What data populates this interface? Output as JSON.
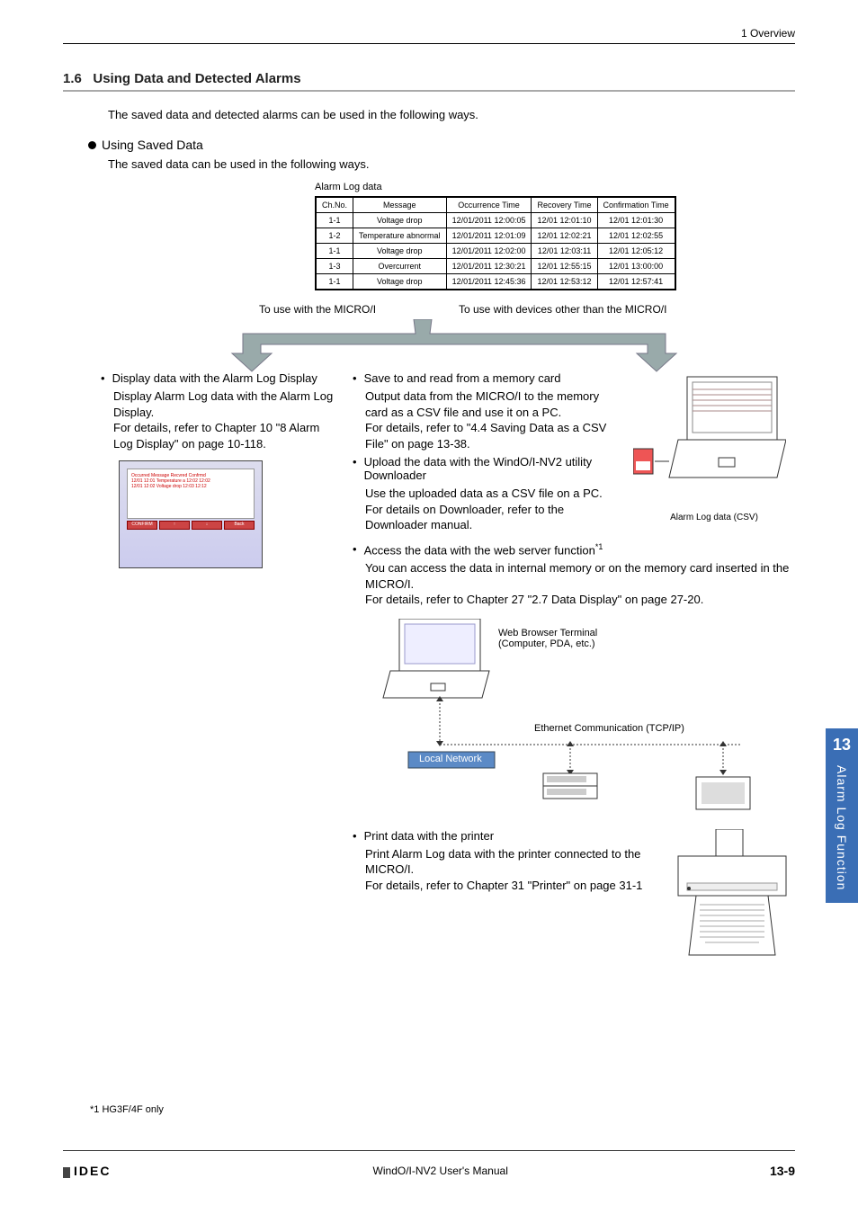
{
  "header": {
    "breadcrumb": "1 Overview"
  },
  "section": {
    "number": "1.6",
    "title": "Using Data and Detected Alarms",
    "intro": "The saved data and detected alarms can be used in the following ways."
  },
  "using_saved_data": {
    "heading": "Using Saved Data",
    "intro": "The saved data can be used in the following ways."
  },
  "alarm_table": {
    "caption": "Alarm Log data",
    "headers": [
      "Ch.No.",
      "Message",
      "Occurrence Time",
      "Recovery Time",
      "Confirmation Time"
    ],
    "rows": [
      [
        "1-1",
        "Voltage drop",
        "12/01/2011 12:00:05",
        "12/01 12:01:10",
        "12/01 12:01:30"
      ],
      [
        "1-2",
        "Temperature abnormal",
        "12/01/2011 12:01:09",
        "12/01 12:02:21",
        "12/01 12:02:55"
      ],
      [
        "1-1",
        "Voltage drop",
        "12/01/2011 12:02:00",
        "12/01 12:03:11",
        "12/01 12:05:12"
      ],
      [
        "1-3",
        "Overcurrent",
        "12/01/2011 12:30:21",
        "12/01 12:55:15",
        "12/01 13:00:00"
      ],
      [
        "1-1",
        "Voltage drop",
        "12/01/2011 12:45:36",
        "12/01 12:53:12",
        "12/01 12:57:41"
      ]
    ]
  },
  "arrows": {
    "left": "To use with the MICRO/I",
    "right": "To use with devices other than the MICRO/I"
  },
  "left_col": {
    "title": "Display data with the Alarm Log Display",
    "desc": "Display Alarm Log data with the Alarm Log Display.\nFor details, refer to Chapter 10 \"8 Alarm Log Display\" on page 10-118.",
    "mock_headers": "Occurred    Message    Recvred  Confrmd",
    "mock_rows": "12/01 12:01  Temperature a  12:02    12:02\n12/01 12:02  Voltage drop   12:03    12:12",
    "mock_buttons": [
      "CONFIRM",
      "↑",
      "↓",
      "Back"
    ]
  },
  "right_col": {
    "memcard": {
      "title": "Save to and read from a memory card",
      "desc": "Output data from the MICRO/I to the memory card as a CSV file and use it on a PC.\nFor details, refer to \"4.4 Saving Data as a CSV File\" on page 13-38."
    },
    "downloader": {
      "title": "Upload the data with the WindO/I-NV2 utility Downloader",
      "desc": "Use the uploaded data as a CSV file on a PC.\nFor details on Downloader, refer to the Downloader manual."
    },
    "csv_caption": "Alarm Log data (CSV)",
    "webserver": {
      "title_prefix": "Access the data with the web server function",
      "sup": "*1",
      "desc": "You can access the data in internal memory or on the memory card inserted in the MICRO/I.\nFor details, refer to Chapter 27 \"2.7 Data Display\" on page 27-20."
    },
    "web_labels": {
      "terminal": "Web Browser Terminal\n(Computer, PDA, etc.)",
      "ethernet": "Ethernet Communication (TCP/IP)",
      "local": "Local Network"
    },
    "printer": {
      "title": "Print data with the printer",
      "desc": "Print Alarm Log data with the printer connected to the MICRO/I.\nFor details, refer to Chapter 31 \"Printer\" on page 31-1"
    }
  },
  "footnote": "*1  HG3F/4F only",
  "footer": {
    "brand": "IDEC",
    "manual": "WindO/I-NV2 User's Manual",
    "page": "13-9"
  },
  "sidetab": {
    "num": "13",
    "text": "Alarm Log Function"
  }
}
